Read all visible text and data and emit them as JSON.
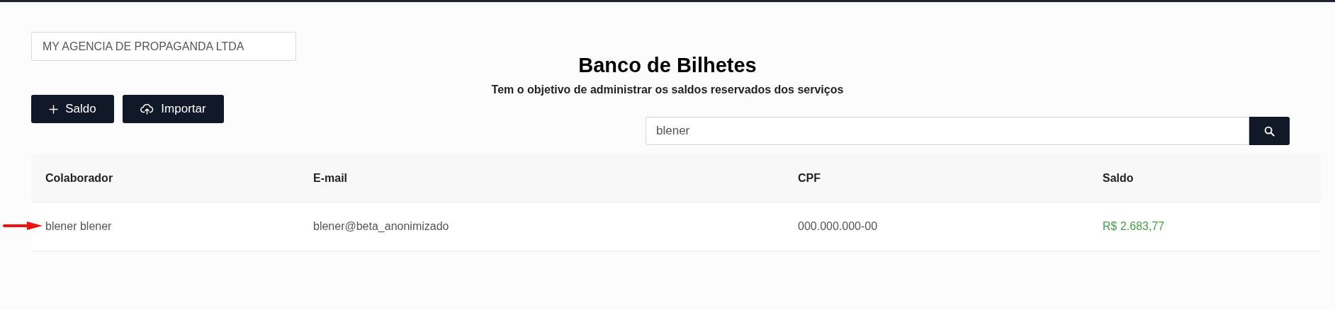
{
  "company_field": {
    "value": "MY AGENCIA DE PROPAGANDA LTDA"
  },
  "title": "Banco de Bilhetes",
  "subtitle": "Tem o objetivo de administrar os saldos reservados dos serviços",
  "buttons": [
    {
      "kind": "add",
      "label": "Saldo"
    },
    {
      "kind": "upload",
      "label": "Importar"
    }
  ],
  "search": {
    "value": "blener"
  },
  "table": {
    "columns": [
      "Colaborador",
      "E-mail",
      "CPF",
      "Saldo"
    ],
    "rows": [
      {
        "cells": [
          "blener blener",
          "blener@beta_anonimizado",
          "000.000.000-00",
          "R$ 2.683,77"
        ],
        "pointed": true
      }
    ]
  }
}
